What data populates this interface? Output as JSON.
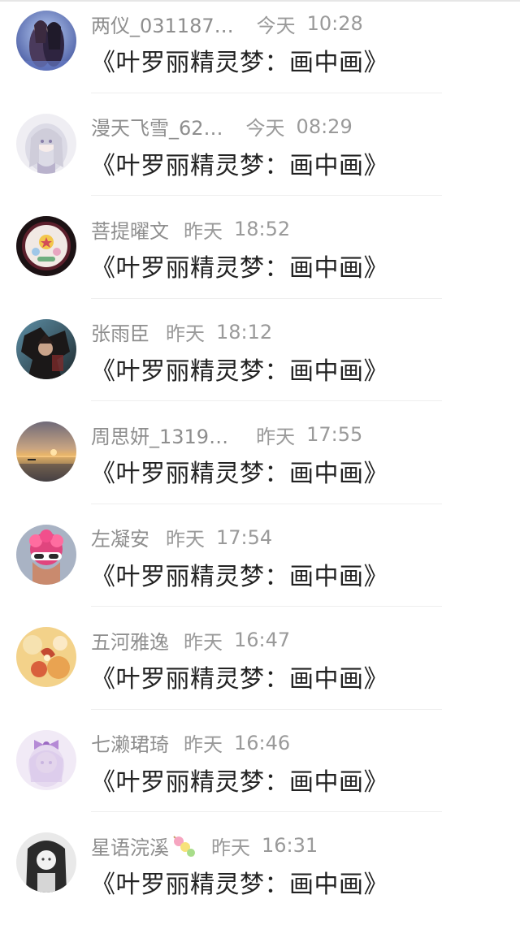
{
  "comments": [
    {
      "username": "两仪_031187…",
      "date": "今天",
      "time": "10:28",
      "message": "《叶罗丽精灵梦：画中画》",
      "avatar": "anime-couple-avatar"
    },
    {
      "username": "漫天飞雪_62…",
      "date": "今天",
      "time": "08:29",
      "message": "《叶罗丽精灵梦：画中画》",
      "avatar": "white-hair-girl-avatar"
    },
    {
      "username": "菩提曜文",
      "date": "昨天",
      "time": "18:52",
      "message": "《叶罗丽精灵梦：画中画》",
      "avatar": "round-emblem-avatar"
    },
    {
      "username": "张雨臣",
      "date": "昨天",
      "time": "18:12",
      "message": "《叶罗丽精灵梦：画中画》",
      "avatar": "dark-character-avatar"
    },
    {
      "username": "周思妍_1319…",
      "date": "昨天",
      "time": "17:55",
      "message": "《叶罗丽精灵梦：画中画》",
      "avatar": "sunset-sea-avatar"
    },
    {
      "username": "左凝安",
      "date": "昨天",
      "time": "17:54",
      "message": "《叶罗丽精灵梦：画中画》",
      "avatar": "pink-hair-sunglasses-avatar"
    },
    {
      "username": "五河雅逸",
      "date": "昨天",
      "time": "16:47",
      "message": "《叶罗丽精灵梦：画中画》",
      "avatar": "warm-floral-avatar"
    },
    {
      "username": "七濑珺琦",
      "date": "昨天",
      "time": "16:46",
      "message": "《叶罗丽精灵梦：画中画》",
      "avatar": "purple-bow-girl-avatar"
    },
    {
      "username": "星语浣溪",
      "date": "昨天",
      "time": "16:31",
      "message": "《叶罗丽精灵梦：画中画》",
      "avatar": "monochrome-girl-avatar",
      "name_emoji": "candy-skewer-icon"
    }
  ],
  "colors": {
    "meta_text": "#9a9a9a",
    "message_text": "#222222",
    "divider": "#eeeeee"
  }
}
